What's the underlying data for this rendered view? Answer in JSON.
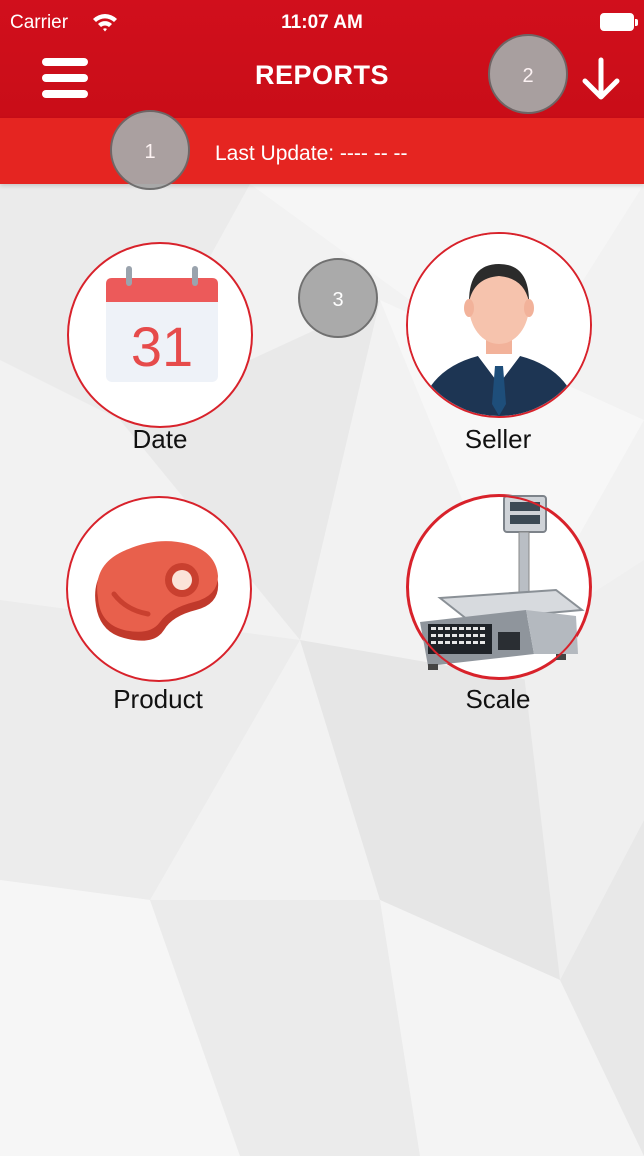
{
  "status_bar": {
    "carrier": "Carrier",
    "time": "11:07 AM"
  },
  "header": {
    "title": "REPORTS"
  },
  "update_bar": {
    "text": "Last Update:  ---- -- --"
  },
  "callouts": [
    "1",
    "2",
    "3"
  ],
  "tiles": [
    {
      "label": "Date",
      "icon": "calendar-icon",
      "calendar_day": "31"
    },
    {
      "label": "Seller",
      "icon": "seller-avatar-icon"
    },
    {
      "label": "Product",
      "icon": "meat-steak-icon"
    },
    {
      "label": "Scale",
      "icon": "weighing-scale-icon"
    }
  ],
  "colors": {
    "header_red": "#d10f1c",
    "update_bar_red": "#e52521",
    "tile_border": "#d8222b"
  }
}
